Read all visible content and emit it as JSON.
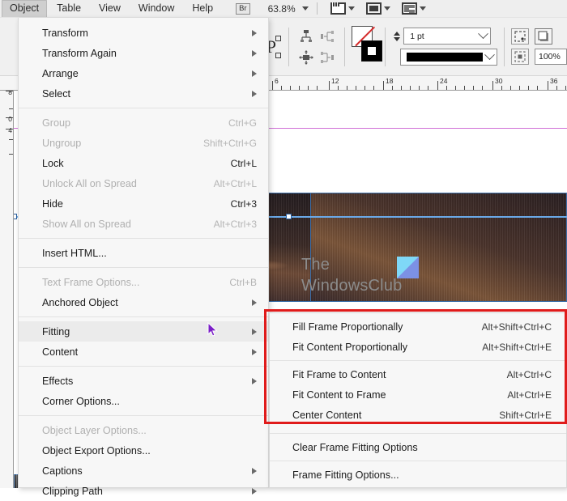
{
  "app": {
    "menubar": {
      "items": [
        {
          "label": "Object",
          "active": true
        },
        {
          "label": "Table",
          "active": false
        },
        {
          "label": "View",
          "active": false
        },
        {
          "label": "Window",
          "active": false
        },
        {
          "label": "Help",
          "active": false
        }
      ],
      "bridge_badge": "Br",
      "zoom_level": "63.8%"
    },
    "control_bar": {
      "stroke_weight": "1 pt",
      "opacity": "100%",
      "icons": [
        "rotate-clockwise-icon",
        "rotate-counterclockwise-icon",
        "paragraph-frame-icon",
        "flip-horizontal-icon",
        "flip-vertical-icon",
        "align-top-icon",
        "align-left-icon",
        "align-center-icon",
        "align-right-icon",
        "stroke-none-swatch",
        "fill-swatch",
        "stroke-weight-stepper",
        "stroke-style-dropdown",
        "effects-icon",
        "drop-shadow-icon",
        "wrap-icon",
        "opacity-field"
      ]
    },
    "ruler": {
      "horizontal_labels": [
        "6",
        "12",
        "18",
        "24",
        "30",
        "36"
      ],
      "vertical_labels": [
        "8",
        "0",
        "4"
      ]
    },
    "canvas": {
      "watermark_line1": "The",
      "watermark_line2": "WindowsClub"
    }
  },
  "object_menu": {
    "groups": [
      {
        "items": [
          {
            "label": "Transform",
            "accel": "",
            "submenu": true,
            "disabled": false
          },
          {
            "label": "Transform Again",
            "accel": "",
            "submenu": true,
            "disabled": false
          },
          {
            "label": "Arrange",
            "accel": "",
            "submenu": true,
            "disabled": false
          },
          {
            "label": "Select",
            "accel": "",
            "submenu": true,
            "disabled": false
          }
        ]
      },
      {
        "items": [
          {
            "label": "Group",
            "accel": "Ctrl+G",
            "submenu": false,
            "disabled": true
          },
          {
            "label": "Ungroup",
            "accel": "Shift+Ctrl+G",
            "submenu": false,
            "disabled": true
          },
          {
            "label": "Lock",
            "accel": "Ctrl+L",
            "submenu": false,
            "disabled": false
          },
          {
            "label": "Unlock All on Spread",
            "accel": "Alt+Ctrl+L",
            "submenu": false,
            "disabled": true
          },
          {
            "label": "Hide",
            "accel": "Ctrl+3",
            "submenu": false,
            "disabled": false
          },
          {
            "label": "Show All on Spread",
            "accel": "Alt+Ctrl+3",
            "submenu": false,
            "disabled": true
          }
        ]
      },
      {
        "items": [
          {
            "label": "Insert HTML...",
            "accel": "",
            "submenu": false,
            "disabled": false
          }
        ]
      },
      {
        "items": [
          {
            "label": "Text Frame Options...",
            "accel": "Ctrl+B",
            "submenu": false,
            "disabled": true
          },
          {
            "label": "Anchored Object",
            "accel": "",
            "submenu": true,
            "disabled": false
          }
        ]
      },
      {
        "items": [
          {
            "label": "Fitting",
            "accel": "",
            "submenu": true,
            "disabled": false,
            "hover": true
          },
          {
            "label": "Content",
            "accel": "",
            "submenu": true,
            "disabled": false
          }
        ]
      },
      {
        "items": [
          {
            "label": "Effects",
            "accel": "",
            "submenu": true,
            "disabled": false
          },
          {
            "label": "Corner Options...",
            "accel": "",
            "submenu": false,
            "disabled": false
          }
        ]
      },
      {
        "items": [
          {
            "label": "Object Layer Options...",
            "accel": "",
            "submenu": false,
            "disabled": true
          },
          {
            "label": "Object Export Options...",
            "accel": "",
            "submenu": false,
            "disabled": false
          },
          {
            "label": "Captions",
            "accel": "",
            "submenu": true,
            "disabled": false
          },
          {
            "label": "Clipping Path",
            "accel": "",
            "submenu": true,
            "disabled": false
          }
        ]
      }
    ]
  },
  "fitting_submenu": {
    "groups": [
      {
        "items": [
          {
            "label": "Fill Frame Proportionally",
            "accel": "Alt+Shift+Ctrl+C"
          },
          {
            "label": "Fit Content Proportionally",
            "accel": "Alt+Shift+Ctrl+E"
          }
        ]
      },
      {
        "items": [
          {
            "label": "Fit Frame to Content",
            "accel": "Alt+Ctrl+C"
          },
          {
            "label": "Fit Content to Frame",
            "accel": "Alt+Ctrl+E"
          },
          {
            "label": "Center Content",
            "accel": "Shift+Ctrl+E"
          }
        ]
      },
      {
        "items": [
          {
            "label": "Clear Frame Fitting Options",
            "accel": ""
          }
        ]
      },
      {
        "items": [
          {
            "label": "Frame Fitting Options...",
            "accel": ""
          }
        ]
      }
    ]
  },
  "annotation": {
    "highlight_color": "#e01b1b"
  }
}
